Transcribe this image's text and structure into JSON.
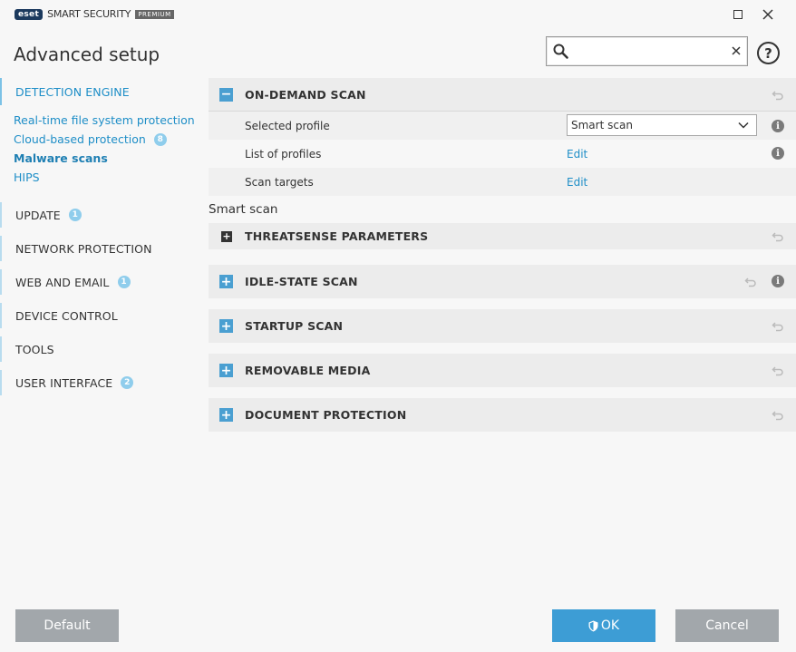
{
  "app": {
    "logo_text": "eset",
    "product_name": "SMART SECURITY",
    "product_tier": "PREMIUM"
  },
  "page": {
    "title": "Advanced setup"
  },
  "search": {
    "value": "",
    "placeholder": ""
  },
  "sidebar": {
    "categories": [
      {
        "label": "DETECTION ENGINE",
        "badge": ""
      },
      {
        "label": "UPDATE",
        "badge": "1"
      },
      {
        "label": "NETWORK PROTECTION",
        "badge": ""
      },
      {
        "label": "WEB AND EMAIL",
        "badge": "1"
      },
      {
        "label": "DEVICE CONTROL",
        "badge": ""
      },
      {
        "label": "TOOLS",
        "badge": ""
      },
      {
        "label": "USER INTERFACE",
        "badge": "2"
      }
    ],
    "detection_items": [
      {
        "label": "Real-time file system protection",
        "badge": ""
      },
      {
        "label": "Cloud-based protection",
        "badge": "8"
      },
      {
        "label": "Malware scans",
        "badge": ""
      },
      {
        "label": "HIPS",
        "badge": ""
      }
    ]
  },
  "content": {
    "on_demand": {
      "title": "ON-DEMAND SCAN",
      "rows": [
        {
          "label": "Selected profile",
          "value": "Smart scan"
        },
        {
          "label": "List of profiles",
          "value": "Edit"
        },
        {
          "label": "Scan targets",
          "value": "Edit"
        }
      ]
    },
    "profile_caption": "Smart scan",
    "threatsense": {
      "title": "THREATSENSE PARAMETERS"
    },
    "sections": [
      {
        "title": "IDLE-STATE SCAN"
      },
      {
        "title": "STARTUP SCAN"
      },
      {
        "title": "REMOVABLE MEDIA"
      },
      {
        "title": "DOCUMENT PROTECTION"
      }
    ]
  },
  "footer": {
    "default_label": "Default",
    "ok_label": "OK",
    "cancel_label": "Cancel"
  },
  "icons": {
    "toggle_minus": "−",
    "toggle_plus": "+",
    "info": "i",
    "help": "?"
  },
  "colors": {
    "accent": "#1e8ec7",
    "toggle": "#4a9fd1",
    "ok_button": "#3d9dd5",
    "neutral_button": "#a2a7ab",
    "badge": "#8fcdec"
  }
}
